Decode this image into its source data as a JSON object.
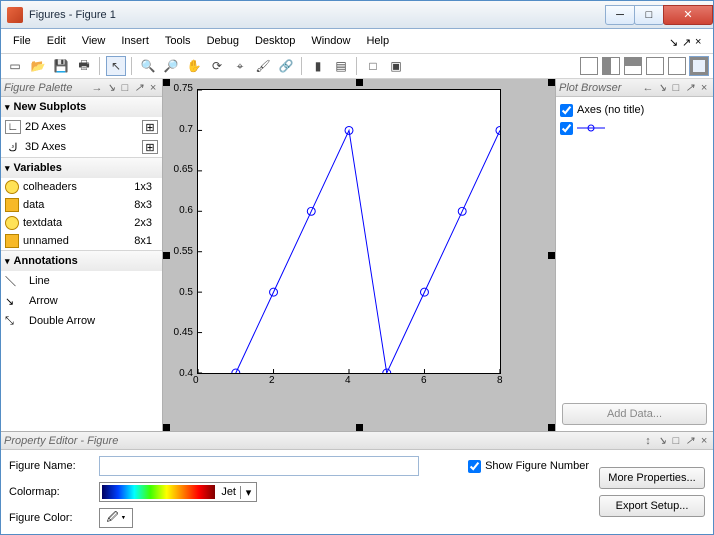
{
  "window": {
    "title": "Figures - Figure 1"
  },
  "menu": [
    "File",
    "Edit",
    "View",
    "Insert",
    "Tools",
    "Debug",
    "Desktop",
    "Window",
    "Help"
  ],
  "panes": {
    "figure_palette": {
      "title": "Figure Palette",
      "new_subplots": {
        "header": "New Subplots",
        "axes2d": "2D Axes",
        "axes3d": "3D Axes"
      },
      "variables": {
        "header": "Variables",
        "items": [
          {
            "name": "colheaders",
            "size": "1x3",
            "type": "cell"
          },
          {
            "name": "data",
            "size": "8x3",
            "type": "num"
          },
          {
            "name": "textdata",
            "size": "2x3",
            "type": "cell"
          },
          {
            "name": "unnamed",
            "size": "8x1",
            "type": "num"
          }
        ]
      },
      "annotations": {
        "header": "Annotations",
        "line": "Line",
        "arrow": "Arrow",
        "double_arrow": "Double Arrow"
      }
    },
    "plot_browser": {
      "title": "Plot Browser",
      "axes_label": "Axes (no title)",
      "add_data": "Add Data..."
    },
    "property_editor": {
      "title": "Property Editor - Figure",
      "figure_name_label": "Figure Name:",
      "figure_name_value": "",
      "show_figure_number": "Show Figure Number",
      "colormap_label": "Colormap:",
      "colormap_name": "Jet",
      "figure_color_label": "Figure Color:",
      "more_properties": "More Properties...",
      "export_setup": "Export Setup..."
    }
  },
  "chart_data": {
    "type": "line",
    "x": [
      1,
      2,
      3,
      4,
      5,
      6,
      7,
      8
    ],
    "y": [
      0.4,
      0.5,
      0.6,
      0.7,
      0.4,
      0.5,
      0.6,
      0.7
    ],
    "xlim": [
      0,
      8
    ],
    "ylim": [
      0.4,
      0.75
    ],
    "xticks": [
      0,
      2,
      4,
      6,
      8
    ],
    "yticks": [
      0.4,
      0.45,
      0.5,
      0.55,
      0.6,
      0.65,
      0.7,
      0.75
    ],
    "title": "",
    "xlabel": "",
    "ylabel": "",
    "marker": "circle",
    "color": "#0000ff"
  }
}
